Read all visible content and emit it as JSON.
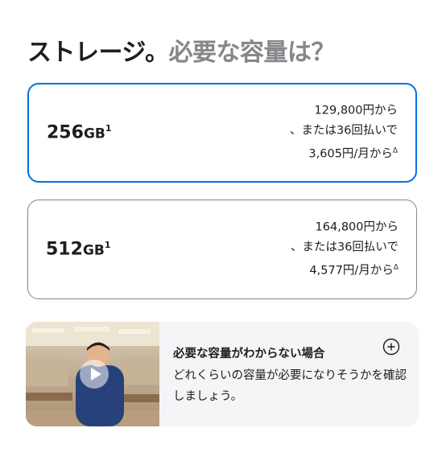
{
  "heading": {
    "main": "ストレージ。",
    "muted": "必要な容量は？"
  },
  "options": [
    {
      "capacity": "256",
      "unit": "GB",
      "footnote": "1",
      "price_line1": "129,800円から",
      "price_line2": "、または36回払いで",
      "price_line3": "3,605円/月から",
      "price_mark": "Δ",
      "selected": true
    },
    {
      "capacity": "512",
      "unit": "GB",
      "footnote": "1",
      "price_line1": "164,800円から",
      "price_line2": "、または36回払いで",
      "price_line3": "4,577円/月から",
      "price_mark": "Δ",
      "selected": false
    }
  ],
  "helper": {
    "title": "必要な容量がわからない場合",
    "body": "どれくらいの容量が必要になりそうかを確認しましょう。",
    "icons": [
      "play-icon",
      "plus-circle-icon"
    ]
  },
  "colors": {
    "accent": "#0071e3",
    "text": "#1d1d1f",
    "muted": "#86868b",
    "panel": "#f5f5f7"
  }
}
